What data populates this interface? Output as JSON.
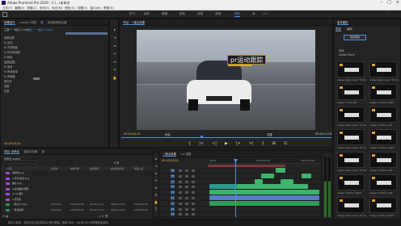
{
  "window": {
    "title": "Adobe Premiere Pro 2019 - C:\\...\\未命名"
  },
  "menu": [
    "文件(F)",
    "编辑(E)",
    "剪辑(C)",
    "序列(S)",
    "标记(M)",
    "图形(G)",
    "视图(V)",
    "窗口(W)",
    "帮助(H)"
  ],
  "workspace_tabs": [
    "学习",
    "组件",
    "编辑",
    "颜色",
    "效果",
    "音频",
    "图形",
    "库",
    ">>"
  ],
  "workspace_active": "图形",
  "left_top": {
    "tabs": [
      "效果控件",
      "Lumetri 范围",
      "源",
      "音频剪辑混合器"
    ],
    "active": "效果控件",
    "source_label": "主要 * 一键点 0.mp4",
    "sequence_label": "一键点 * 一键点 0.mp4",
    "timecode_start": "00:00:04:24",
    "rows": [
      "视频效果",
      "fx 运动",
      "fx 不透明度",
      "fx 时间重映射",
      "fx 颜色",
      "音频效果",
      "fx 音量",
      "fx 声道音量",
      "fx 声像器",
      "源文本",
      "变换",
      "位置"
    ]
  },
  "program": {
    "tab": "节目：一键点效果",
    "overlay_text": "pr运动跟踪",
    "timecode_left": "00:00:04:24",
    "fit": "适合",
    "scale": "完整",
    "timecode_right": "00:00:11:00",
    "transport": [
      "{",
      "|<",
      "<|",
      "▶",
      "|>",
      ">|",
      "}",
      "⊞",
      "⊡"
    ]
  },
  "right_panel": {
    "tabs": [
      "基本图形",
      "浏览",
      "编辑"
    ],
    "button": "我的模板",
    "rows": [
      "本地",
      "Adobe Stock"
    ],
    "thumb_labels": [
      "Image Label Lower Thirds",
      "Image Label Lower Thirds",
      "Image 1 Title Left",
      "Image 1 Sticker Right",
      "Image Label Lower Thirds",
      "Image 2 Sticker Left",
      "Image Label Lower Thirds",
      "Image 2 Sticker Right",
      "Image Label Lower Thirds",
      "Image 3 Sticker Left",
      "Image 3 Sticker Right",
      "Image 4 Sticker Left",
      "Image Label Lower Thirds",
      "Image 5 Sticker Right"
    ]
  },
  "project": {
    "tabs": [
      "项目: 未命名",
      "媒体浏览器",
      "库"
    ],
    "file_name": "未命名.prproj",
    "search_placeholder": "",
    "count": "6 项",
    "columns": [
      "名称",
      "帧速率",
      "媒体开始",
      "媒体结束",
      "媒体持续时间",
      "视频入点"
    ],
    "items": [
      {
        "name": "素材类.png",
        "fps": "",
        "start": "",
        "end": "",
        "dur": "",
        "in": ""
      },
      {
        "name": "A 序列 新建.png",
        "fps": "",
        "start": "",
        "end": "",
        "dur": "",
        "in": ""
      },
      {
        "name": "图片.png",
        "fps": "",
        "start": "",
        "end": "",
        "dur": "",
        "in": ""
      },
      {
        "name": "pr运动跟踪 图形",
        "fps": "",
        "start": "",
        "end": "",
        "dur": "",
        "in": ""
      },
      {
        "name": "小 Ae 图片",
        "fps": "",
        "start": "",
        "end": "",
        "dur": "",
        "in": ""
      },
      {
        "name": "A 序列名",
        "fps": "",
        "start": "",
        "end": "",
        "dur": "",
        "in": ""
      },
      {
        "name": "一键点 0.mp4",
        "fps": "25.00 fps",
        "start": "00:00:00:00",
        "end": "00:00:11:24",
        "dur": "00:00:12:00",
        "in": "00:00:00:00"
      },
      {
        "name": "一键点效果",
        "fps": "25.00 fps",
        "start": "00:00:00:00",
        "end": "00:00:11:24",
        "dur": "00:00:12:00",
        "in": "00:00:00:00"
      }
    ]
  },
  "timeline": {
    "tabs": [
      "一键点效果",
      "Lut 调整"
    ],
    "timecode": "00:00:04:24",
    "ruler_marks": [
      "00:00",
      "00:00:05:00",
      "00:00:10:00"
    ],
    "tracks": [
      "V6",
      "V5",
      "V4",
      "V3",
      "V2",
      "V1",
      "A1",
      "A2",
      "A3"
    ],
    "master": "主声道"
  },
  "tools": [
    "▸",
    "⇥",
    "⇔",
    "✂",
    "↔",
    "✎",
    "✋",
    "T"
  ],
  "status": "单击以选择，或单击空白处并拖动以进行框选。使用 Shift、Alt 和 Ctrl 可获得其他选项。",
  "colors": {
    "accent": "#4d8fe7",
    "timecode": "#e7b84d",
    "clip_green": "#3fb46b",
    "clip_teal": "#2a9b8c"
  }
}
